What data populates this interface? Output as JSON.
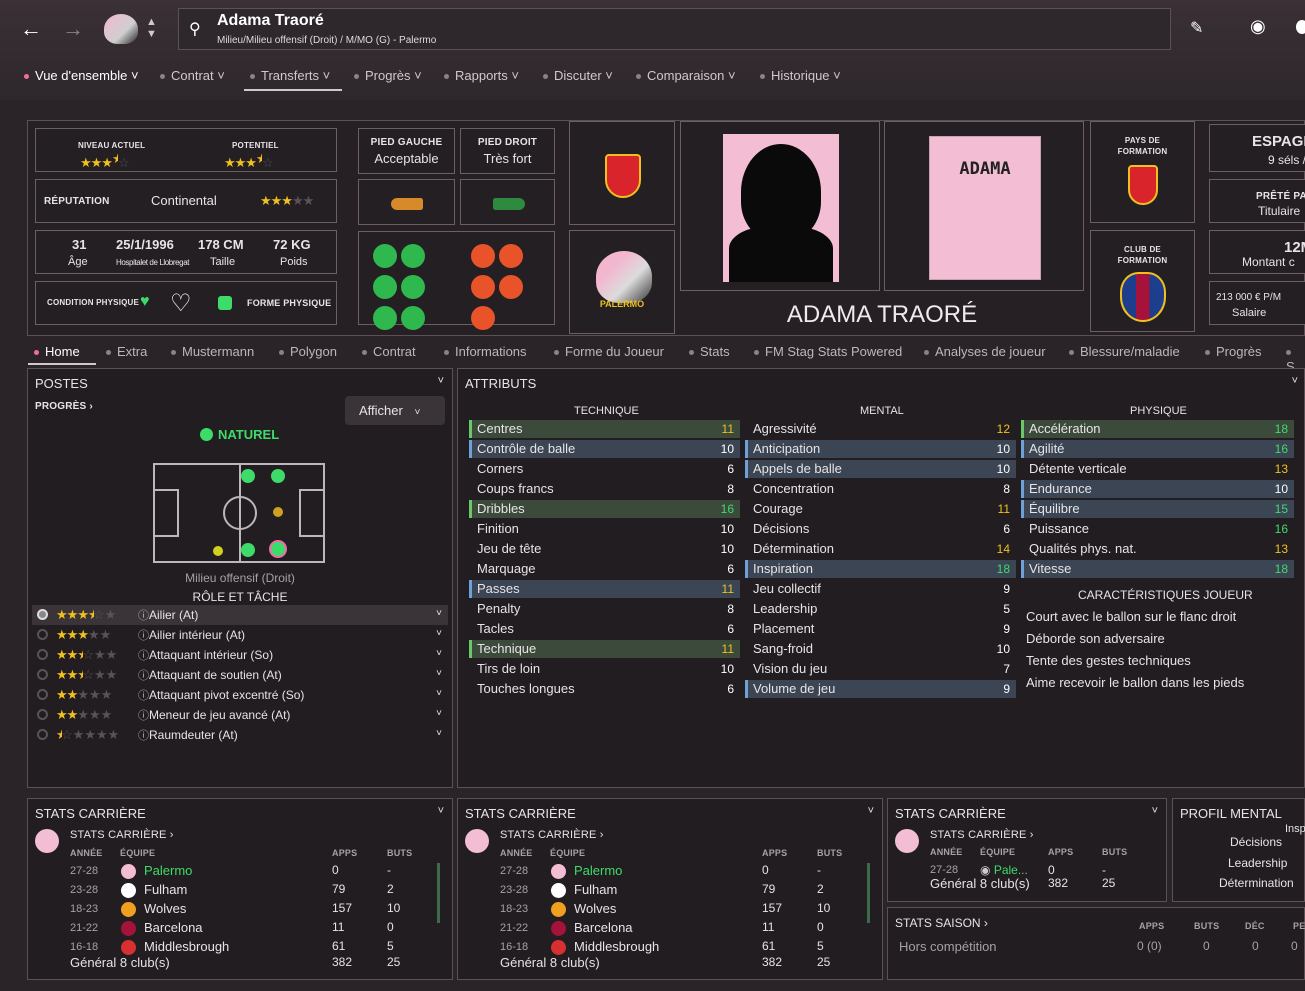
{
  "header": {
    "name": "Adama Traoré",
    "subtitle": "Milieu/Milieu offensif (Droit) / M/MO (G) - Palermo"
  },
  "nav": [
    "Vue d'ensemble",
    "Contrat",
    "Transferts",
    "Progrès",
    "Rapports",
    "Discuter",
    "Comparaison",
    "Historique"
  ],
  "level": {
    "current_label": "NIVEAU ACTUEL",
    "potential_label": "POTENTIEL",
    "current_stars": 3.5,
    "potential_stars": 3.5
  },
  "reputation": {
    "label": "RÉPUTATION",
    "value": "Continental",
    "stars": 3
  },
  "bio": {
    "age": "31",
    "age_label": "Âge",
    "dob": "25/1/1996",
    "birthplace": "Hospitalet de Llobregat",
    "height": "178 CM",
    "height_label": "Taille",
    "weight": "72 KG",
    "weight_label": "Poids"
  },
  "condition": {
    "phys_label": "CONDITION PHYSIQUE",
    "form_label": "FORME PHYSIQUE"
  },
  "feet": {
    "left_label": "PIED GAUCHE",
    "left_value": "Acceptable",
    "right_label": "PIED DROIT",
    "right_value": "Très fort"
  },
  "card": {
    "shirt_name": "ADAMA",
    "full_name": "ADAMA TRAORÉ",
    "club_badge": "PALERMO"
  },
  "origin": {
    "country_label": "PAYS DE FORMATION",
    "club_label": "CLUB DE FORMATION"
  },
  "right_cards": {
    "nation": "ESPAGN",
    "caps": "9 séls /",
    "loan_label": "PRÊTÉ PA",
    "loan_value": "Titulaire",
    "value_big": "12M",
    "value_label": "Montant c",
    "wage": "213 000 € P/M",
    "wage_label": "Salaire"
  },
  "subnav": [
    "Home",
    "Extra",
    "Mustermann",
    "Polygon",
    "Contrat",
    "Informations",
    "Forme du Joueur",
    "Stats",
    "FM Stag Stats Powered",
    "Analyses de joueur",
    "Blessure/maladie",
    "Progrès",
    "S"
  ],
  "positions": {
    "title": "POSTES",
    "progress_link": "PROGRÈS",
    "show_button": "Afficher",
    "natural_label": "NATUREL",
    "position_text": "Milieu offensif (Droit)",
    "role_title": "RÔLE ET TÂCHE",
    "roles": [
      {
        "name": "Ailier (At)",
        "stars": 3.5
      },
      {
        "name": "Ailier intérieur (At)",
        "stars": 3
      },
      {
        "name": "Attaquant intérieur (So)",
        "stars": 2.5
      },
      {
        "name": "Attaquant de soutien (At)",
        "stars": 2.5
      },
      {
        "name": "Attaquant pivot excentré (So)",
        "stars": 2
      },
      {
        "name": "Meneur de jeu avancé (At)",
        "stars": 2
      },
      {
        "name": "Raumdeuter (At)",
        "stars": 0.5
      }
    ]
  },
  "attributes": {
    "title": "ATTRIBUTS",
    "technique": {
      "title": "TECHNIQUE",
      "items": [
        [
          "Centres",
          "11"
        ],
        [
          "Contrôle de balle",
          "10"
        ],
        [
          "Corners",
          "6"
        ],
        [
          "Coups francs",
          "8"
        ],
        [
          "Dribbles",
          "16"
        ],
        [
          "Finition",
          "10"
        ],
        [
          "Jeu de tête",
          "10"
        ],
        [
          "Marquage",
          "6"
        ],
        [
          "Passes",
          "11"
        ],
        [
          "Penalty",
          "8"
        ],
        [
          "Tacles",
          "6"
        ],
        [
          "Technique",
          "11"
        ],
        [
          "Tirs de loin",
          "10"
        ],
        [
          "Touches longues",
          "6"
        ]
      ]
    },
    "mental": {
      "title": "MENTAL",
      "items": [
        [
          "Agressivité",
          "12"
        ],
        [
          "Anticipation",
          "10"
        ],
        [
          "Appels de balle",
          "10"
        ],
        [
          "Concentration",
          "8"
        ],
        [
          "Courage",
          "11"
        ],
        [
          "Décisions",
          "6"
        ],
        [
          "Détermination",
          "14"
        ],
        [
          "Inspiration",
          "18"
        ],
        [
          "Jeu collectif",
          "9"
        ],
        [
          "Leadership",
          "5"
        ],
        [
          "Placement",
          "9"
        ],
        [
          "Sang-froid",
          "10"
        ],
        [
          "Vision du jeu",
          "7"
        ],
        [
          "Volume de jeu",
          "9"
        ]
      ]
    },
    "physique": {
      "title": "PHYSIQUE",
      "items": [
        [
          "Accélération",
          "18"
        ],
        [
          "Agilité",
          "16"
        ],
        [
          "Détente verticale",
          "13"
        ],
        [
          "Endurance",
          "10"
        ],
        [
          "Équilibre",
          "15"
        ],
        [
          "Puissance",
          "16"
        ],
        [
          "Qualités phys. nat.",
          "13"
        ],
        [
          "Vitesse",
          "18"
        ]
      ]
    },
    "traits_title": "CARACTÉRISTIQUES JOUEUR",
    "traits": [
      "Court avec le ballon sur le flanc droit",
      "Déborde son adversaire",
      "Tente des gestes techniques",
      "Aime recevoir le ballon dans les pieds"
    ]
  },
  "career": {
    "title": "STATS CARRIÈRE",
    "link": "STATS CARRIÈRE",
    "cols": [
      "ANNÉE",
      "ÉQUIPE",
      "APPS",
      "BUTS"
    ],
    "rows": [
      [
        "27-28",
        "Palermo",
        "0",
        "-"
      ],
      [
        "23-28",
        "Fulham",
        "79",
        "2"
      ],
      [
        "18-23",
        "Wolves",
        "157",
        "10"
      ],
      [
        "21-22",
        "Barcelona",
        "11",
        "0"
      ],
      [
        "16-18",
        "Middlesbrough",
        "61",
        "5"
      ]
    ],
    "total_label": "Général 8 club(s)",
    "total_apps": "382",
    "total_goals": "25",
    "short_team": "Pale..."
  },
  "mental_profile": {
    "title": "PROFIL MENTAL",
    "labels": [
      "Insp",
      "Décisions",
      "Leadership",
      "Détermination"
    ]
  },
  "season": {
    "title": "STATS SAISON",
    "cols": [
      "APPS",
      "BUTS",
      "DÉC",
      "PE"
    ],
    "row_label": "Hors compétition",
    "values": [
      "0 (0)",
      "0",
      "0",
      "0"
    ]
  }
}
